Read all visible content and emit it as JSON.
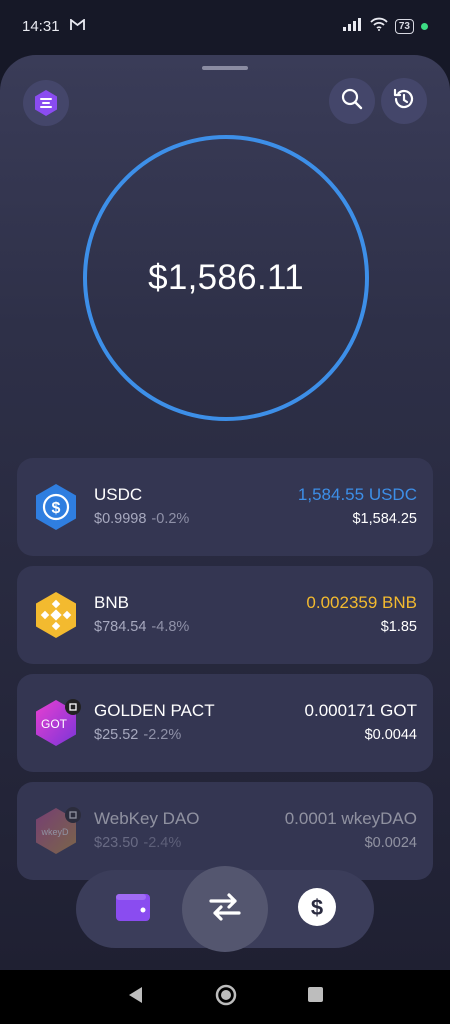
{
  "status_bar": {
    "time": "14:31",
    "battery": "73",
    "icons": [
      "gmail-icon",
      "signal-icon",
      "wifi-icon",
      "battery-icon",
      "green-dot-indicator"
    ]
  },
  "header": {
    "logo_icon": "app-logo-icon",
    "search_icon": "search-icon",
    "history_icon": "history-icon"
  },
  "balance": {
    "total": "$1,586.11",
    "ring_color": "#3d8fe8"
  },
  "tokens": [
    {
      "name": "USDC",
      "price": "$0.9998",
      "change": "-0.2%",
      "amount": "1,584.55 USDC",
      "amount_color": "#3d8fe8",
      "value": "$1,584.25",
      "icon": "usdc-icon"
    },
    {
      "name": "BNB",
      "price": "$784.54",
      "change": "-4.8%",
      "amount": "0.002359 BNB",
      "amount_color": "#f3ba2f",
      "value": "$1.85",
      "icon": "bnb-icon"
    },
    {
      "name": "GOLDEN PACT",
      "price": "$25.52",
      "change": "-2.2%",
      "amount": "0.000171 GOT",
      "amount_color": "#ffffff",
      "value": "$0.0044",
      "icon": "got-icon",
      "icon_text": "GOT"
    },
    {
      "name": "WebKey DAO",
      "price": "$23.50",
      "change": "-2.4%",
      "amount": "0.0001 wkeyDAO",
      "amount_color": "#ffffff",
      "value": "$0.0024",
      "icon": "webkey-icon",
      "icon_text": "wkeyD"
    }
  ],
  "bottom_nav": {
    "items": [
      "wallet-icon",
      "swap-icon",
      "dollar-icon"
    ],
    "active": "swap"
  },
  "android_nav": [
    "back-icon",
    "home-icon",
    "recents-icon"
  ]
}
